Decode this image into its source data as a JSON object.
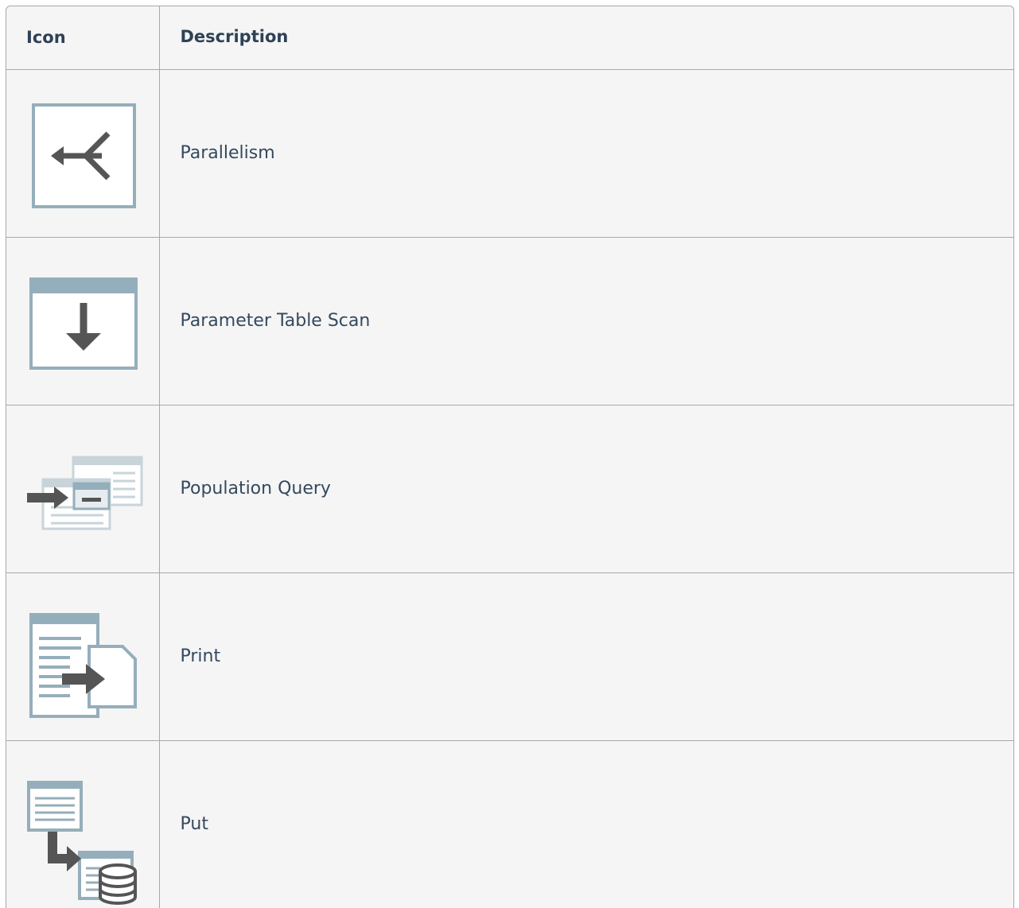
{
  "table": {
    "headers": {
      "icon": "Icon",
      "description": "Description"
    },
    "rows": [
      {
        "icon": "parallelism-icon",
        "description": "Parallelism"
      },
      {
        "icon": "parameter-table-scan-icon",
        "description": "Parameter Table Scan"
      },
      {
        "icon": "population-query-icon",
        "description": "Population Query"
      },
      {
        "icon": "print-icon",
        "description": "Print"
      },
      {
        "icon": "put-icon",
        "description": "Put"
      }
    ]
  },
  "colors": {
    "icon_frame": "#95aebb",
    "icon_fill": "#ffffff",
    "icon_arrow": "#555555",
    "icon_light_frame": "#c8d4da",
    "cell_background": "#f5f5f5",
    "border": "#a8a8a8",
    "text": "#34495e"
  }
}
